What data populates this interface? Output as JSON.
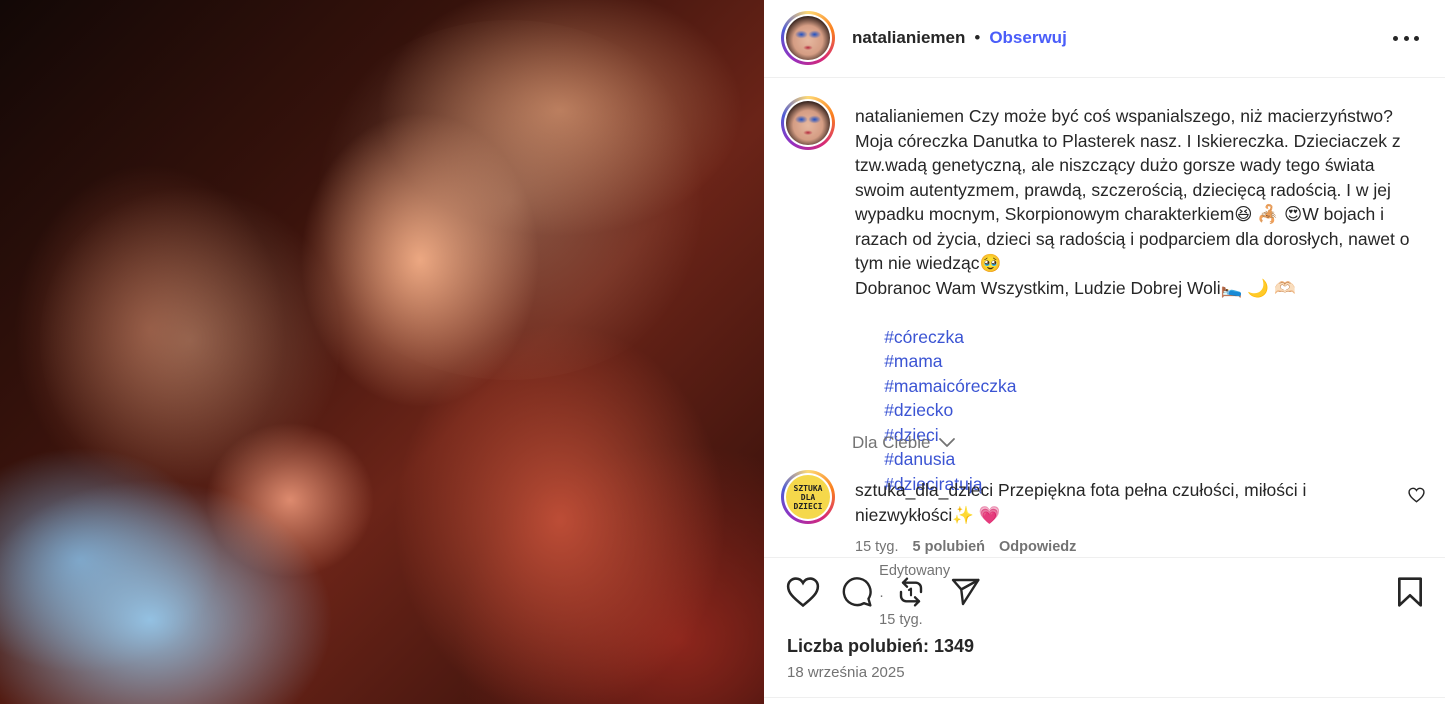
{
  "post": {
    "author": "natalianiemen",
    "separator": "•",
    "follow_label": "Obserwuj",
    "more_icon": "more-options-icon"
  },
  "caption": {
    "username": "natalianiemen",
    "text": "Czy może być coś wspanialszego, niż macierzyństwo? Moja córeczka Danutka to Plasterek nasz. I Iskiereczka. Dzieciaczek z tzw.wadą genetyczną, ale niszczący dużo gorsze wady tego świata swoim autentyzmem, prawdą, szczerością, dziecięcą radością. I w jej wypadku mocnym, Skorpionowym charakterkiem😆 🦂 😍W bojach i razach od życia, dzieci są radością i podparciem dla dorosłych, nawet o tym nie wiedząc🥹",
    "text2": "Dobranoc Wam Wszystkim, Ludzie Dobrej Woli🛌 🌙 🫶🏻",
    "hashtags": [
      "#córeczka",
      "#mama",
      "#mamaicóreczka",
      "#dziecko",
      "#dzieci",
      "#danusia",
      "#dzieciratują"
    ],
    "edited": "Edytowany",
    "meta_sep": "·",
    "age": "15 tyg."
  },
  "for_you": {
    "label": "Dla Ciebie",
    "icon": "chevron-down-icon"
  },
  "comment": {
    "username": "sztuka_dla_dzieci",
    "avatar_text": [
      "SZTUKA",
      "DLA",
      "DZIECI"
    ],
    "text": "Przepiękna fota pełna czułości, miłości i niezwykłości✨ 💗",
    "age": "15 tyg.",
    "likes": "5 polubień",
    "reply": "Odpowiedz"
  },
  "actions": {
    "like_icon": "heart-icon",
    "comment_icon": "comment-icon",
    "repost_icon": "repost-icon",
    "share_icon": "send-icon",
    "save_icon": "bookmark-icon",
    "likes_label": "Liczba polubień: 1349",
    "date": "18 września 2025"
  },
  "colors": {
    "link_blue": "#4a5df9",
    "hashtag_blue": "#3b54d3",
    "muted": "#737373",
    "text": "#262626"
  }
}
